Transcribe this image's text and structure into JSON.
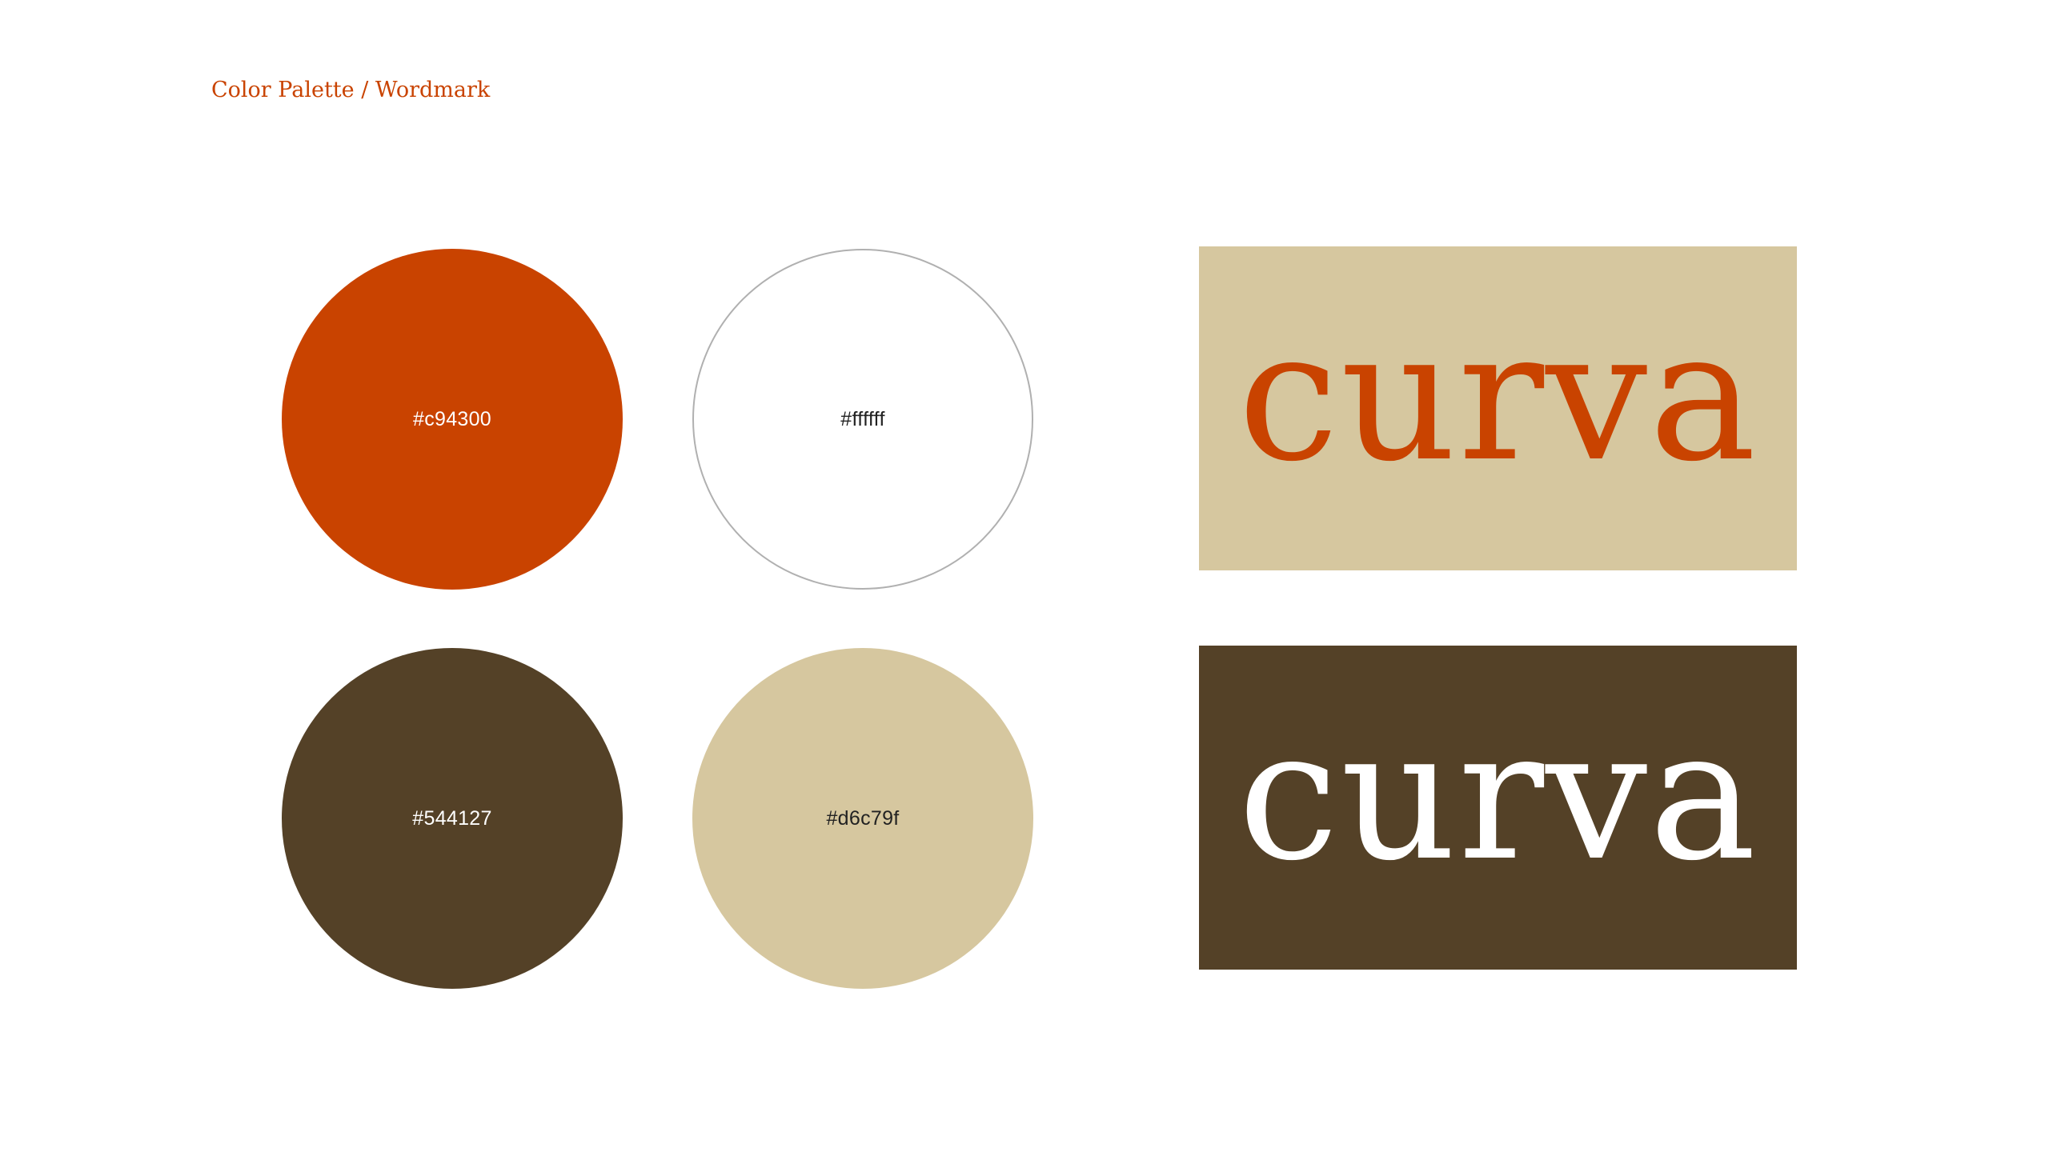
{
  "page": {
    "title": "Color Palette / Wordmark",
    "title_color": "#c94300"
  },
  "palette": [
    {
      "name": "orange",
      "hex": "#c94300",
      "label": "#c94300",
      "label_color": "#ffffff"
    },
    {
      "name": "white",
      "hex": "#ffffff",
      "label": "#ffffff",
      "label_color": "#222222"
    },
    {
      "name": "brown",
      "hex": "#544127",
      "label": "#544127",
      "label_color": "#ffffff"
    },
    {
      "name": "beige",
      "hex": "#d6c79f",
      "label": "#d6c79f",
      "label_color": "#222222"
    }
  ],
  "wordmarks": [
    {
      "text": "curva",
      "background": "#d6c79f",
      "text_color": "#c94300"
    },
    {
      "text": "curva",
      "background": "#544127",
      "text_color": "#ffffff"
    }
  ]
}
